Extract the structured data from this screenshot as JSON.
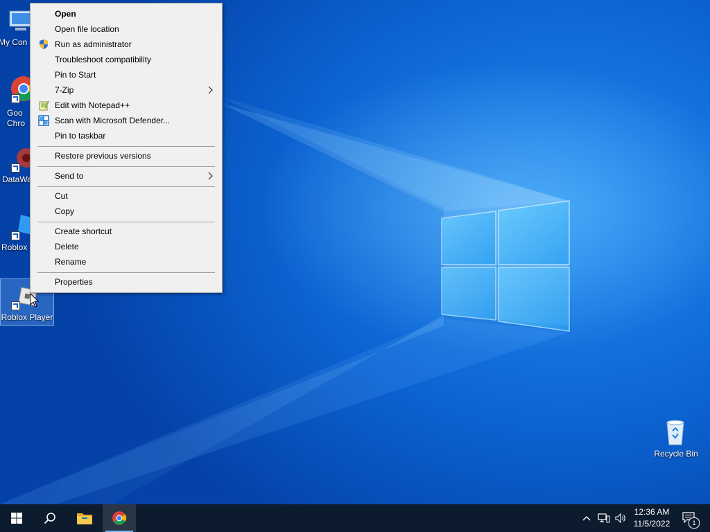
{
  "desktop": {
    "icons": [
      {
        "label": "My Con"
      },
      {
        "label": "Goo\nChro"
      },
      {
        "label": "DataWa"
      },
      {
        "label": "Roblox"
      },
      {
        "label": "Roblox Player"
      },
      {
        "label": "Recycle Bin"
      }
    ]
  },
  "context_menu": {
    "items": [
      {
        "label": "Open",
        "icon": "",
        "bold": true
      },
      {
        "label": "Open file location",
        "icon": ""
      },
      {
        "label": "Run as administrator",
        "icon": "uac-shield-icon"
      },
      {
        "label": "Troubleshoot compatibility",
        "icon": ""
      },
      {
        "label": "Pin to Start",
        "icon": ""
      },
      {
        "label": "7-Zip",
        "icon": "",
        "submenu": true
      },
      {
        "label": "Edit with Notepad++",
        "icon": "notepad-plus-plus-icon"
      },
      {
        "label": "Scan with Microsoft Defender...",
        "icon": "defender-icon"
      },
      {
        "label": "Pin to taskbar",
        "icon": ""
      },
      {
        "label": "Restore previous versions",
        "icon": ""
      },
      {
        "label": "Send to",
        "icon": "",
        "submenu": true
      },
      {
        "label": "Cut",
        "icon": ""
      },
      {
        "label": "Copy",
        "icon": ""
      },
      {
        "label": "Create shortcut",
        "icon": ""
      },
      {
        "label": "Delete",
        "icon": ""
      },
      {
        "label": "Rename",
        "icon": ""
      },
      {
        "label": "Properties",
        "icon": ""
      }
    ]
  },
  "taskbar": {
    "buttons": [
      "start-icon",
      "search-icon",
      "file-explorer-icon",
      "chrome-icon"
    ],
    "tray_icons": [
      "chevron-up-icon",
      "network-icon",
      "volume-icon"
    ],
    "clock": {
      "time": "12:36 AM",
      "date": "11/5/2022"
    },
    "notifications": {
      "count": "1"
    }
  },
  "colors": {
    "accent": "#0c63d2",
    "taskbar": "#0c1b2d",
    "menu_bg": "#f0f0f0"
  }
}
